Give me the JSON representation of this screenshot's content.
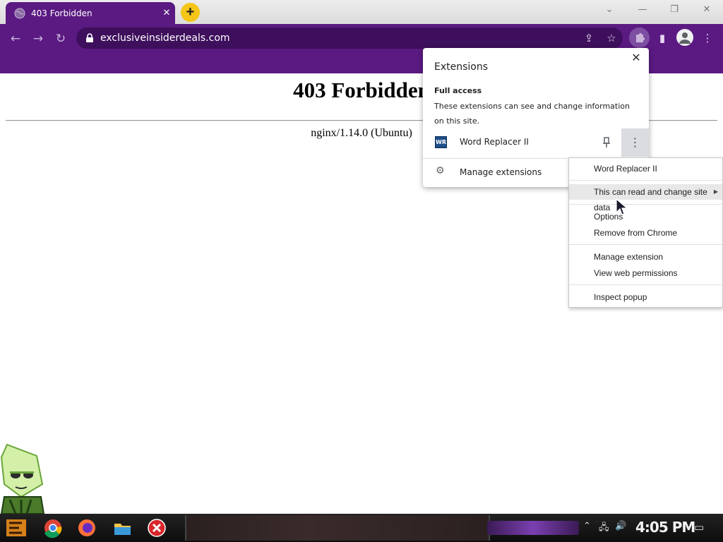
{
  "browser": {
    "tab_title": "403 Forbidden",
    "tab_close": "✕",
    "new_tab": "+",
    "window_controls": {
      "tab_search": "⌄",
      "minimize": "—",
      "restore": "❐",
      "close": "✕"
    },
    "url": "exclusiveinsiderdeals.com",
    "icons": [
      "back-icon",
      "forward-icon",
      "reload-icon",
      "lock-icon",
      "share-icon",
      "bookmark-star-icon",
      "extensions-icon",
      "side-panel-icon",
      "profile-icon",
      "menu-icon"
    ],
    "theme_color": "#5a1a82"
  },
  "page": {
    "title": "403 Forbidden",
    "server": "nginx/1.14.0 (Ubuntu)"
  },
  "extensions_popup": {
    "header": "Extensions",
    "close": "✕",
    "section": "Full access",
    "description": "These extensions can see and change information on this site.",
    "extension_name": "Word Replacer II",
    "extension_icon_text": "WR",
    "manage": "Manage extensions"
  },
  "context_menu": {
    "items": [
      "Word Replacer II",
      "This can read and change site data",
      "Options",
      "Remove from Chrome",
      "Manage extension",
      "View web permissions",
      "Inspect popup"
    ],
    "highlighted": "This can read and change site data"
  },
  "taskbar": {
    "clock": "4:05 PM",
    "icons": [
      "start-icon",
      "chrome-icon",
      "firefox-icon",
      "folder-icon",
      "close-app-icon",
      "network-icon",
      "volume-icon",
      "notification-icon"
    ]
  }
}
